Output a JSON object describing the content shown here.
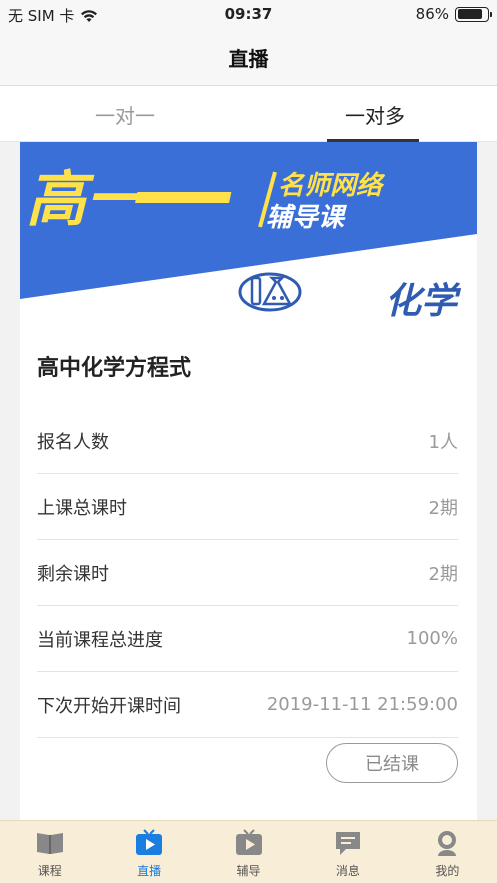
{
  "status_bar": {
    "carrier": "无 SIM 卡",
    "time": "09:37",
    "battery": "86%",
    "battery_level": 0.86
  },
  "nav": {
    "title": "直播"
  },
  "tabs": [
    {
      "label": "一对一",
      "active": false
    },
    {
      "label": "一对多",
      "active": true
    }
  ],
  "banner": {
    "grade_text": "高一",
    "tagline_1": "名师网络",
    "tagline_2": "辅导课",
    "subject": "化学",
    "accent_color": "#3b6fd8",
    "highlight_color": "#ffe14a"
  },
  "course": {
    "title": "高中化学方程式",
    "rows": [
      {
        "label": "报名人数",
        "value": "1人"
      },
      {
        "label": "上课总课时",
        "value": "2期"
      },
      {
        "label": "剩余课时",
        "value": "2期"
      },
      {
        "label": "当前课程总进度",
        "value": "100%"
      },
      {
        "label": "下次开始开课时间",
        "value": "2019-11-11 21:59:00"
      }
    ],
    "status_button": "已结课"
  },
  "tabbar": [
    {
      "label": "课程",
      "icon": "book-icon",
      "active": false
    },
    {
      "label": "直播",
      "icon": "live-tv-icon",
      "active": true
    },
    {
      "label": "辅导",
      "icon": "tutor-tv-icon",
      "active": false
    },
    {
      "label": "消息",
      "icon": "message-icon",
      "active": false
    },
    {
      "label": "我的",
      "icon": "profile-icon",
      "active": false
    }
  ]
}
